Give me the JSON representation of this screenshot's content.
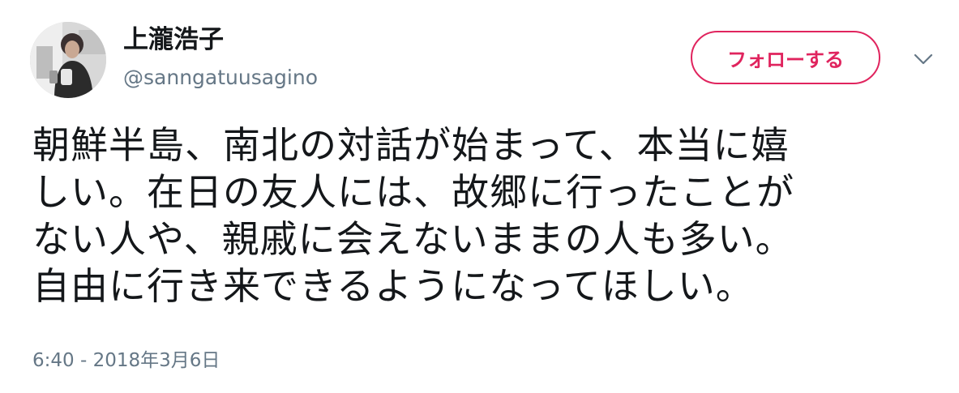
{
  "user": {
    "display_name": "上瀧浩子",
    "handle": "@sanngatuusagino",
    "avatar_icon": "profile-photo"
  },
  "actions": {
    "follow_label": "フォローする",
    "menu_icon": "chevron-down-icon"
  },
  "tweet": {
    "lines": [
      "朝鮮半島、南北の対話が始まって、本当に嬉",
      "しい。在日の友人には、故郷に行ったことが",
      "ない人や、親戚に会えないままの人も多い。",
      "自由に行き来できるようになってほしい。"
    ],
    "timestamp": "6:40 - 2018年3月6日"
  },
  "colors": {
    "text": "#14171a",
    "secondary": "#657786",
    "follow_accent": "#e0245e",
    "background": "#ffffff"
  }
}
